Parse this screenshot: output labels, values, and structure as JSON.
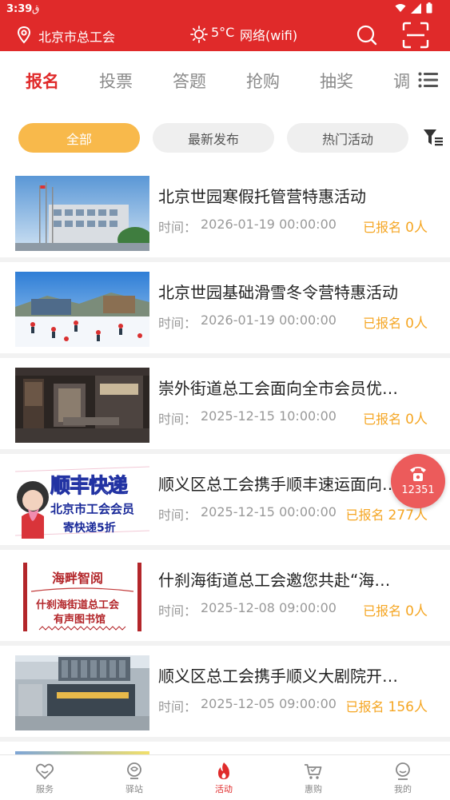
{
  "status_bar": {
    "time": "3:39",
    "notification": "ق"
  },
  "header": {
    "location": "北京市总工会",
    "temperature": "5°C",
    "network": "网络(wifi)"
  },
  "category_tabs": [
    "报名",
    "投票",
    "答题",
    "抢购",
    "抽奖",
    "调"
  ],
  "filters": [
    "全部",
    "最新发布",
    "热门活动"
  ],
  "time_label": "时间：",
  "signup_label": "已报名",
  "activities": [
    {
      "title": "北京世园寒假托管营特惠活动",
      "time": "2026-01-19 00:00:00",
      "count": "0人"
    },
    {
      "title": "北京世园基础滑雪冬令营特惠活动",
      "time": "2026-01-19 00:00:00",
      "count": "0人"
    },
    {
      "title": "崇外街道总工会面向全市会员优…",
      "time": "2025-12-15 10:00:00",
      "count": "0人"
    },
    {
      "title": "顺义区总工会携手顺丰速运面向…",
      "time": "2025-12-15 00:00:00",
      "count": "277人"
    },
    {
      "title": "什刹海街道总工会邀您共赴“海…",
      "time": "2025-12-08 09:00:00",
      "count": "0人"
    },
    {
      "title": "顺义区总工会携手顺义大剧院开…",
      "time": "2025-12-05 09:00:00",
      "count": "156人"
    }
  ],
  "thumb_text": {
    "sf_big": "顺丰快递",
    "sf_mid": "北京市工会会员",
    "sf_small": "寄快递5折",
    "sh_top": "海畔智阅",
    "sh_mid": "什刹海街道总工会",
    "sh_bot": "有声图书馆"
  },
  "hotline": {
    "number": "12351"
  },
  "bottom_nav": [
    {
      "label": "服务",
      "icon": "heart-icon"
    },
    {
      "label": "驿站",
      "icon": "station-icon"
    },
    {
      "label": "活动",
      "icon": "flame-icon"
    },
    {
      "label": "惠购",
      "icon": "cart-icon"
    },
    {
      "label": "我的",
      "icon": "user-icon"
    }
  ],
  "colors": {
    "brand_red": "#e02a2a",
    "accent_orange": "#f8b94b",
    "count_orange": "#f5a623"
  }
}
